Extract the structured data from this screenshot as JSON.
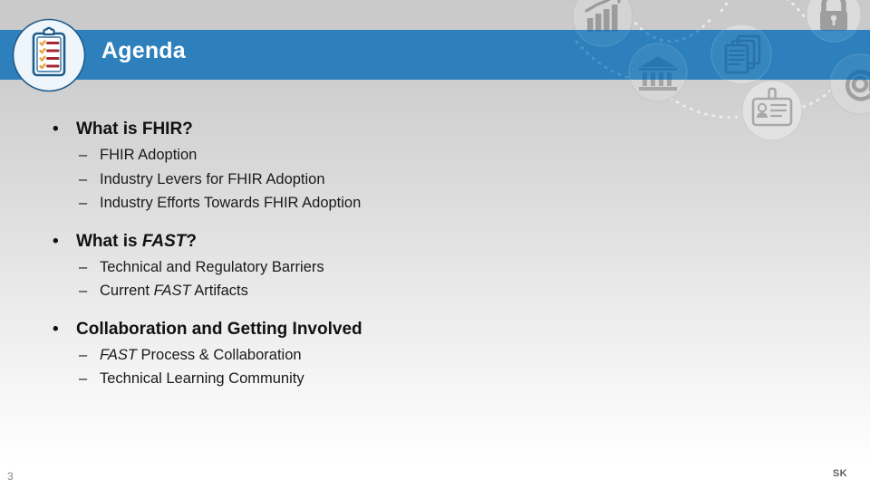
{
  "slide": {
    "title": "Agenda",
    "page_number": "3",
    "footer_initials": "SK",
    "colors": {
      "banner_blue": "#2E80BC",
      "title_text": "#FFFFFF",
      "body_text": "#111111",
      "background_top": "#C9C9C9",
      "background_bottom": "#FFFFFF",
      "badge_ring": "#1F5C8B",
      "badge_check": "#E8A33D",
      "badge_line": "#A32833"
    },
    "badge_icon": "clipboard-checklist-icon",
    "decorative_icons": [
      "bar-chart-growth-icon",
      "padlock-icon",
      "bank-building-icon",
      "stacked-documents-icon",
      "id-badge-icon",
      "at-sign-icon"
    ]
  },
  "content": {
    "groups": [
      {
        "heading_prefix": "What is ",
        "heading_keyword": "",
        "heading_suffix": "FHIR?",
        "heading_plain": "What is FHIR?",
        "bullet_marker": "•",
        "sub_marker": "–",
        "items": [
          {
            "prefix": "FHIR Adoption",
            "keyword": "",
            "suffix": ""
          },
          {
            "prefix": "Industry Levers for FHIR Adoption",
            "keyword": "",
            "suffix": ""
          },
          {
            "prefix": "Industry Efforts Towards FHIR Adoption",
            "keyword": "",
            "suffix": ""
          }
        ]
      },
      {
        "heading_prefix": "What is ",
        "heading_keyword": "FAST",
        "heading_suffix": "?",
        "heading_plain": "What is FAST?",
        "bullet_marker": "•",
        "sub_marker": "–",
        "items": [
          {
            "prefix": "Technical and Regulatory Barriers",
            "keyword": "",
            "suffix": ""
          },
          {
            "prefix": "Current ",
            "keyword": "FAST",
            "suffix": " Artifacts"
          }
        ]
      },
      {
        "heading_prefix": "Collaboration and Getting Involved",
        "heading_keyword": "",
        "heading_suffix": "",
        "heading_plain": "Collaboration and Getting Involved",
        "bullet_marker": "•",
        "sub_marker": "–",
        "items": [
          {
            "prefix": "",
            "keyword": "FAST",
            "suffix": " Process & Collaboration"
          },
          {
            "prefix": "Technical Learning Community",
            "keyword": "",
            "suffix": ""
          }
        ]
      }
    ]
  }
}
